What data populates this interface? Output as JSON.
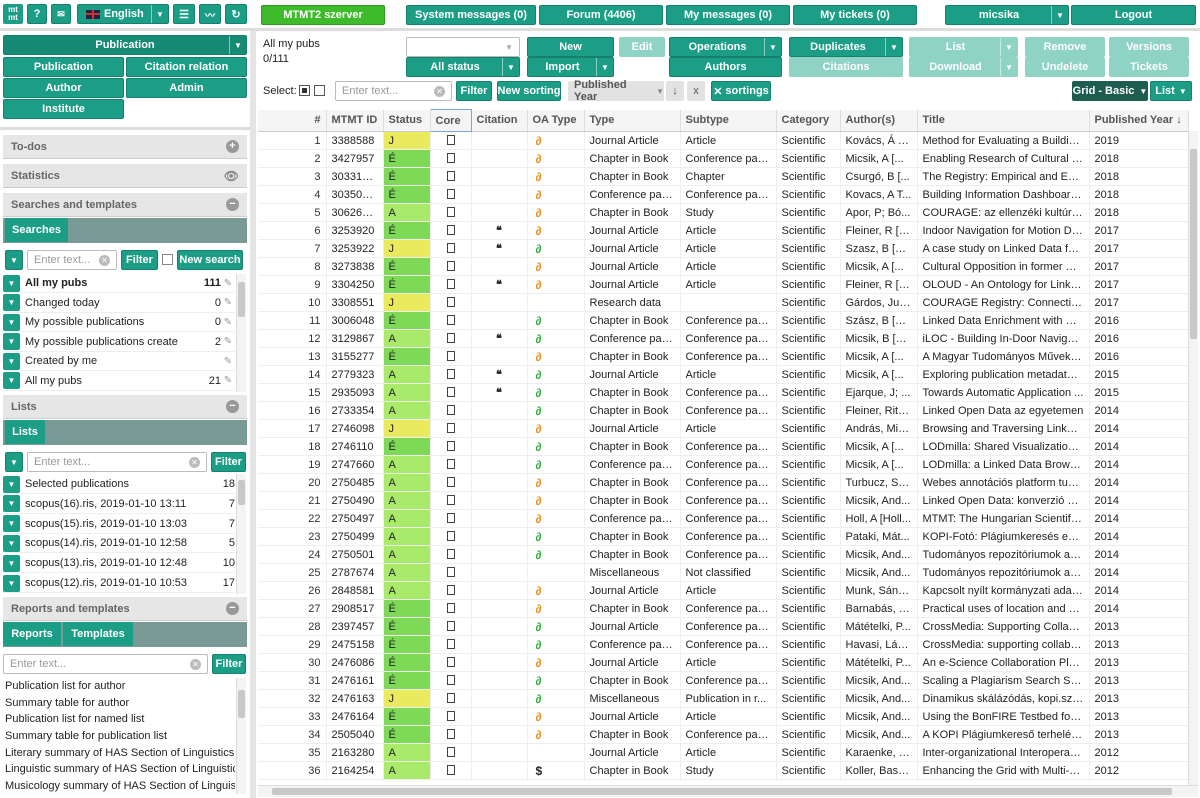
{
  "top": {
    "logo": "mt mt",
    "help": "?",
    "lang": "English",
    "left_btn": "MTMT2 szerver",
    "sys_msg": "System messages (0)",
    "forum": "Forum (4406)",
    "my_msg": "My messages (0)",
    "tickets": "My tickets (0)",
    "user": "micsika",
    "logout": "Logout"
  },
  "nav": {
    "main": "Publication",
    "buttons": [
      "Publication",
      "Citation relation",
      "Author",
      "Admin",
      "Institute"
    ]
  },
  "sections": {
    "todos": "To-dos",
    "stats": "Statistics",
    "searches_h": "Searches and templates",
    "searches_tab": "Searches",
    "search_placeholder": "Enter text...",
    "filter": "Filter",
    "new_search": "New search",
    "searches": [
      {
        "label": "All my pubs",
        "n": "111"
      },
      {
        "label": "Changed today",
        "n": "0"
      },
      {
        "label": "My possible publications",
        "n": "0"
      },
      {
        "label": "My possible publications create",
        "n": "2"
      },
      {
        "label": "Created by me",
        "n": ""
      },
      {
        "label": "All my pubs",
        "n": "21"
      }
    ],
    "lists_h": "Lists",
    "lists_tab": "Lists",
    "lists": [
      {
        "label": "Selected publications",
        "n": "18"
      },
      {
        "label": "scopus(16).ris, 2019-01-10 13:11",
        "n": "7"
      },
      {
        "label": "scopus(15).ris, 2019-01-10 13:03",
        "n": "7"
      },
      {
        "label": "scopus(14).ris, 2019-01-10 12:58",
        "n": "5"
      },
      {
        "label": "scopus(13).ris, 2019-01-10 12:48",
        "n": "10"
      },
      {
        "label": "scopus(12).ris, 2019-01-10 10:53",
        "n": "17"
      }
    ],
    "reports_h": "Reports and templates",
    "reports_tab": "Reports",
    "templates_tab": "Templates",
    "templates": [
      "Publication list for author",
      "Summary table for author",
      "Publication list for named list",
      "Summary table for publication list",
      "Literary summary of HAS Section of Linguistics an",
      "Linguistic summary of HAS Section of Linguistics",
      "Musicology summary of HAS Section of Linguistic"
    ]
  },
  "toolbar": {
    "title": "All my pubs",
    "count": "0/111",
    "new": "New",
    "edit": "Edit",
    "operations": "Operations",
    "duplicates": "Duplicates",
    "list": "List",
    "remove": "Remove",
    "versions": "Versions",
    "all_status": "All status",
    "import": "Import",
    "authors": "Authors",
    "citations": "Citations",
    "download": "Download",
    "undelete": "Undelete",
    "tickets": "Tickets",
    "select": "Select:",
    "filter_placeholder": "Enter text...",
    "filter": "Filter",
    "new_sorting": "New sorting",
    "sort_field": "Published Year",
    "sort_dir": "↓",
    "sort_x": "x",
    "sortings": "sortings",
    "grid_mode": "Grid - Basic",
    "list_mode": "List"
  },
  "columns": [
    "#",
    "MTMT ID",
    "Status",
    "Core",
    "Citation",
    "OA Type",
    "Type",
    "Subtype",
    "Category",
    "Author(s)",
    "Title",
    "Published Year ↓"
  ],
  "rows": [
    [
      1,
      "3388588",
      "J",
      "d",
      "",
      "o",
      "Journal Article",
      "Article",
      "Scientific",
      "Kovács, Á T...",
      "Method for Evaluating a Building...",
      "2019"
    ],
    [
      2,
      "3427957",
      "É",
      "d",
      "",
      "o",
      "Chapter in Book",
      "Conference paper",
      "Scientific",
      "Micsik, A [...",
      "Enabling Research of Cultural H...",
      "2018"
    ],
    [
      3,
      "30331323",
      "É",
      "d",
      "",
      "o",
      "Chapter in Book",
      "Chapter",
      "Scientific",
      "Csurgó, B [...",
      "The Registry: Empirical and Epi...",
      "2018"
    ],
    [
      4,
      "30350314",
      "É",
      "d",
      "",
      "o",
      "Conference paper",
      "Conference paper",
      "Scientific",
      "Kovacs, A T...",
      "Building Information Dashboard ...",
      "2018"
    ],
    [
      5,
      "30626669",
      "A",
      "d",
      "",
      "o",
      "Chapter in Book",
      "Study",
      "Scientific",
      "Apor, P; Bó...",
      "COURAGE: az ellenzéki kultúra...",
      "2018"
    ],
    [
      6,
      "3253920",
      "É",
      "d",
      "q",
      "o",
      "Journal Article",
      "Article",
      "Scientific",
      "Fleiner, R [F...",
      "Indoor Navigation for Motion Dis...",
      "2017"
    ],
    [
      7,
      "3253922",
      "J",
      "d",
      "q",
      "g",
      "Journal Article",
      "Article",
      "Scientific",
      "Szasz, B [S...",
      "A case study on Linked Data for...",
      "2017"
    ],
    [
      8,
      "3273838",
      "É",
      "d",
      "",
      "o",
      "Journal Article",
      "Article",
      "Scientific",
      "Micsik, A [...",
      "Cultural Opposition in former Eu...",
      "2017"
    ],
    [
      9,
      "3304250",
      "É",
      "d",
      "q",
      "o",
      "Journal Article",
      "Article",
      "Scientific",
      "Fleiner, R [F...",
      "OLOUD - An Ontology for Linke...",
      "2017"
    ],
    [
      10,
      "3308551",
      "J",
      "d",
      "",
      "",
      "Research data",
      "",
      "Scientific",
      "Gárdos, Jud...",
      "COURAGE Registry: Connectin...",
      "2017"
    ],
    [
      11,
      "3006048",
      "É",
      "d",
      "",
      "g",
      "Chapter in Book",
      "Conference paper",
      "Scientific",
      "Szász, B [S...",
      "Linked Data Enrichment with Se...",
      "2016"
    ],
    [
      12,
      "3129867",
      "A",
      "d",
      "q",
      "g",
      "Conference paper",
      "Conference paper",
      "Scientific",
      "Micsik, B [S...",
      "iLOC - Building In-Door Navigati...",
      "2016"
    ],
    [
      13,
      "3155277",
      "É",
      "d",
      "",
      "o",
      "Chapter in Book",
      "Conference paper",
      "Scientific",
      "Micsik, A [...",
      "A Magyar Tudományos Művek T...",
      "2016"
    ],
    [
      14,
      "2779323",
      "A",
      "d",
      "q",
      "g",
      "Journal Article",
      "Article",
      "Scientific",
      "Micsik, A [...",
      "Exploring publication metadata ...",
      "2015"
    ],
    [
      15,
      "2935093",
      "A",
      "d",
      "q",
      "g",
      "Chapter in Book",
      "Conference paper",
      "Scientific",
      "Ejarque, J; ...",
      "Towards Automatic Application ...",
      "2015"
    ],
    [
      16,
      "2733354",
      "A",
      "d",
      "",
      "g",
      "Chapter in Book",
      "Conference paper",
      "Scientific",
      "Fleiner, Rita...",
      "Linked Open Data az egyetemen",
      "2014"
    ],
    [
      17,
      "2746098",
      "J",
      "d",
      "",
      "o",
      "Journal Article",
      "Article",
      "Scientific",
      "András, Mic...",
      "Browsing and Traversing Linked ...",
      "2014"
    ],
    [
      18,
      "2746110",
      "É",
      "d",
      "",
      "g",
      "Chapter in Book",
      "Conference paper",
      "Scientific",
      "Micsik, A [...",
      "LODmilla: Shared Visualization ...",
      "2014"
    ],
    [
      19,
      "2747660",
      "A",
      "d",
      "",
      "g",
      "Conference paper",
      "Conference paper",
      "Scientific",
      "Micsik, A [...",
      "LODmilla: a Linked Data Brows...",
      "2014"
    ],
    [
      20,
      "2750485",
      "A",
      "d",
      "",
      "o",
      "Chapter in Book",
      "Conference paper",
      "Scientific",
      "Turbucz, Sá...",
      "Webes annotációs platform tudo...",
      "2014"
    ],
    [
      21,
      "2750490",
      "A",
      "d",
      "",
      "o",
      "Chapter in Book",
      "Conference paper",
      "Scientific",
      "Micsik, And...",
      "Linked Open Data: konverzió és...",
      "2014"
    ],
    [
      22,
      "2750497",
      "A",
      "d",
      "",
      "o",
      "Conference paper",
      "Conference paper",
      "Scientific",
      "Holl, A [Holl...",
      "MTMT: The Hungarian Scientific ...",
      "2014"
    ],
    [
      23,
      "2750499",
      "A",
      "d",
      "",
      "g",
      "Chapter in Book",
      "Conference paper",
      "Scientific",
      "Pataki, Mát...",
      "KOPI-Fotó: Plágiumkeresés egy...",
      "2014"
    ],
    [
      24,
      "2750501",
      "A",
      "d",
      "",
      "g",
      "Chapter in Book",
      "Conference paper",
      "Scientific",
      "Micsik, And...",
      "Tudományos repozitóriumok az ...",
      "2014"
    ],
    [
      25,
      "2787674",
      "A",
      "d",
      "",
      "",
      "Miscellaneous",
      "Not classified",
      "Scientific",
      "Micsik, And...",
      "Tudományos repozitóriumok az ...",
      "2014"
    ],
    [
      26,
      "2848581",
      "A",
      "d",
      "",
      "o",
      "Journal Article",
      "Article",
      "Scientific",
      "Munk, Sánd...",
      "Kapcsolt nyílt kormányzati adat...",
      "2014"
    ],
    [
      27,
      "2908517",
      "É",
      "d",
      "",
      "o",
      "Chapter in Book",
      "Conference paper",
      "Scientific",
      "Barnabás, S...",
      "Practical uses of location and ev...",
      "2014"
    ],
    [
      28,
      "2397457",
      "É",
      "d",
      "",
      "g",
      "Journal Article",
      "Conference pap...",
      "Scientific",
      "Mátételki, P...",
      "CrossMedia: Supporting Collabo...",
      "2013"
    ],
    [
      29,
      "2475158",
      "É",
      "d",
      "",
      "g",
      "Conference paper",
      "Conference paper",
      "Scientific",
      "Havasi, Lás...",
      "CrossMedia: supporting collabor...",
      "2013"
    ],
    [
      30,
      "2476086",
      "É",
      "d",
      "",
      "o",
      "Journal Article",
      "Article",
      "Scientific",
      "Mátételki, P...",
      "An e-Science Collaboration Platf...",
      "2013"
    ],
    [
      31,
      "2476161",
      "É",
      "d",
      "",
      "g",
      "Chapter in Book",
      "Conference paper",
      "Scientific",
      "Micsik, And...",
      "Scaling a Plagiarism Search Se...",
      "2013"
    ],
    [
      32,
      "2476163",
      "J",
      "d",
      "",
      "g",
      "Miscellaneous",
      "Publication in r...",
      "Scientific",
      "Micsik, And...",
      "Dinamikus skálázódás, kopi.szt...",
      "2013"
    ],
    [
      33,
      "2476164",
      "É",
      "d",
      "",
      "o",
      "Journal Article",
      "Article",
      "Scientific",
      "Micsik, And...",
      "Using the BonFIRE Testbed for ...",
      "2013"
    ],
    [
      34,
      "2505040",
      "É",
      "d",
      "",
      "o",
      "Chapter in Book",
      "Conference paper",
      "Scientific",
      "Micsik, And...",
      "A KOPI Plágiumkereső terhelés...",
      "2013"
    ],
    [
      35,
      "2163280",
      "A",
      "d",
      "",
      "",
      "Journal Article",
      "Article",
      "Scientific",
      "Karaenke, P...",
      "Inter-organizational Interoperabili...",
      "2012"
    ],
    [
      36,
      "2164254",
      "A",
      "d",
      "",
      "$",
      "Chapter in Book",
      "Study",
      "Scientific",
      "Koller, Basti...",
      "Enhancing the Grid with Multi-a...",
      "2012"
    ]
  ]
}
